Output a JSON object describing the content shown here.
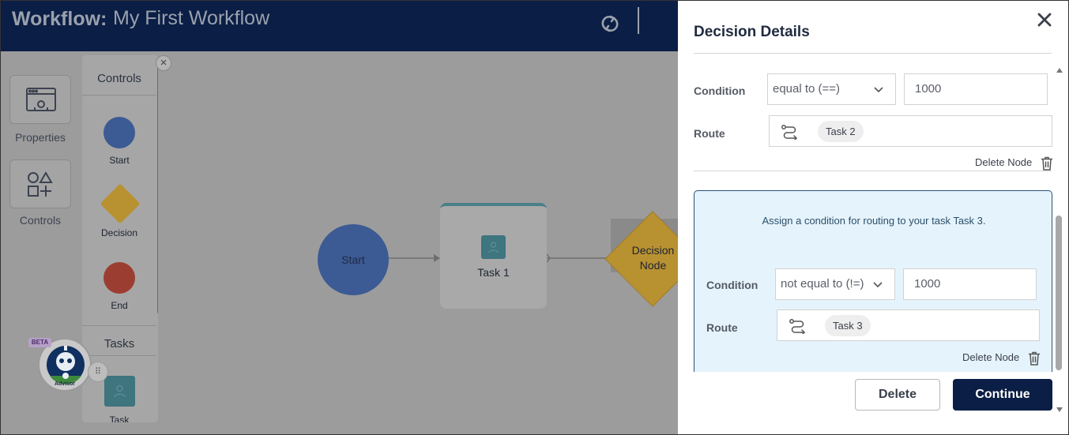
{
  "header": {
    "label": "Workflow:",
    "name": "My First Workflow"
  },
  "rail": {
    "properties_label": "Properties",
    "controls_label": "Controls"
  },
  "palette": {
    "controls_heading": "Controls",
    "tasks_heading": "Tasks",
    "items": [
      {
        "label": "Start",
        "color": "#3c5a93"
      },
      {
        "label": "Decision",
        "color": "#b89131"
      },
      {
        "label": "End",
        "color": "#9b3e31"
      },
      {
        "label": "Task",
        "color": "#3e757e"
      }
    ]
  },
  "canvas_nodes": {
    "start": "Start",
    "task": "Task 1",
    "decision_line1": "Decision",
    "decision_line2": "Node"
  },
  "advisor": {
    "badge": "BETA",
    "label": "Advisor"
  },
  "drawer": {
    "title": "Decision Details",
    "rule1": {
      "condition_label": "Condition",
      "operator": "equal to (==)",
      "value": "1000",
      "route_label": "Route",
      "route_chip": "Task 2",
      "delete_label": "Delete Node"
    },
    "rule2": {
      "message": "Assign a condition for routing to your task Task 3.",
      "condition_label": "Condition",
      "operator": "not equal to (!=)",
      "value": "1000",
      "route_label": "Route",
      "route_chip": "Task 3",
      "delete_label": "Delete Node"
    },
    "footer": {
      "delete_label": "Delete",
      "continue_label": "Continue"
    }
  },
  "colors": {
    "navy": "#0b1e45",
    "card_bg": "#e5f3fc"
  }
}
